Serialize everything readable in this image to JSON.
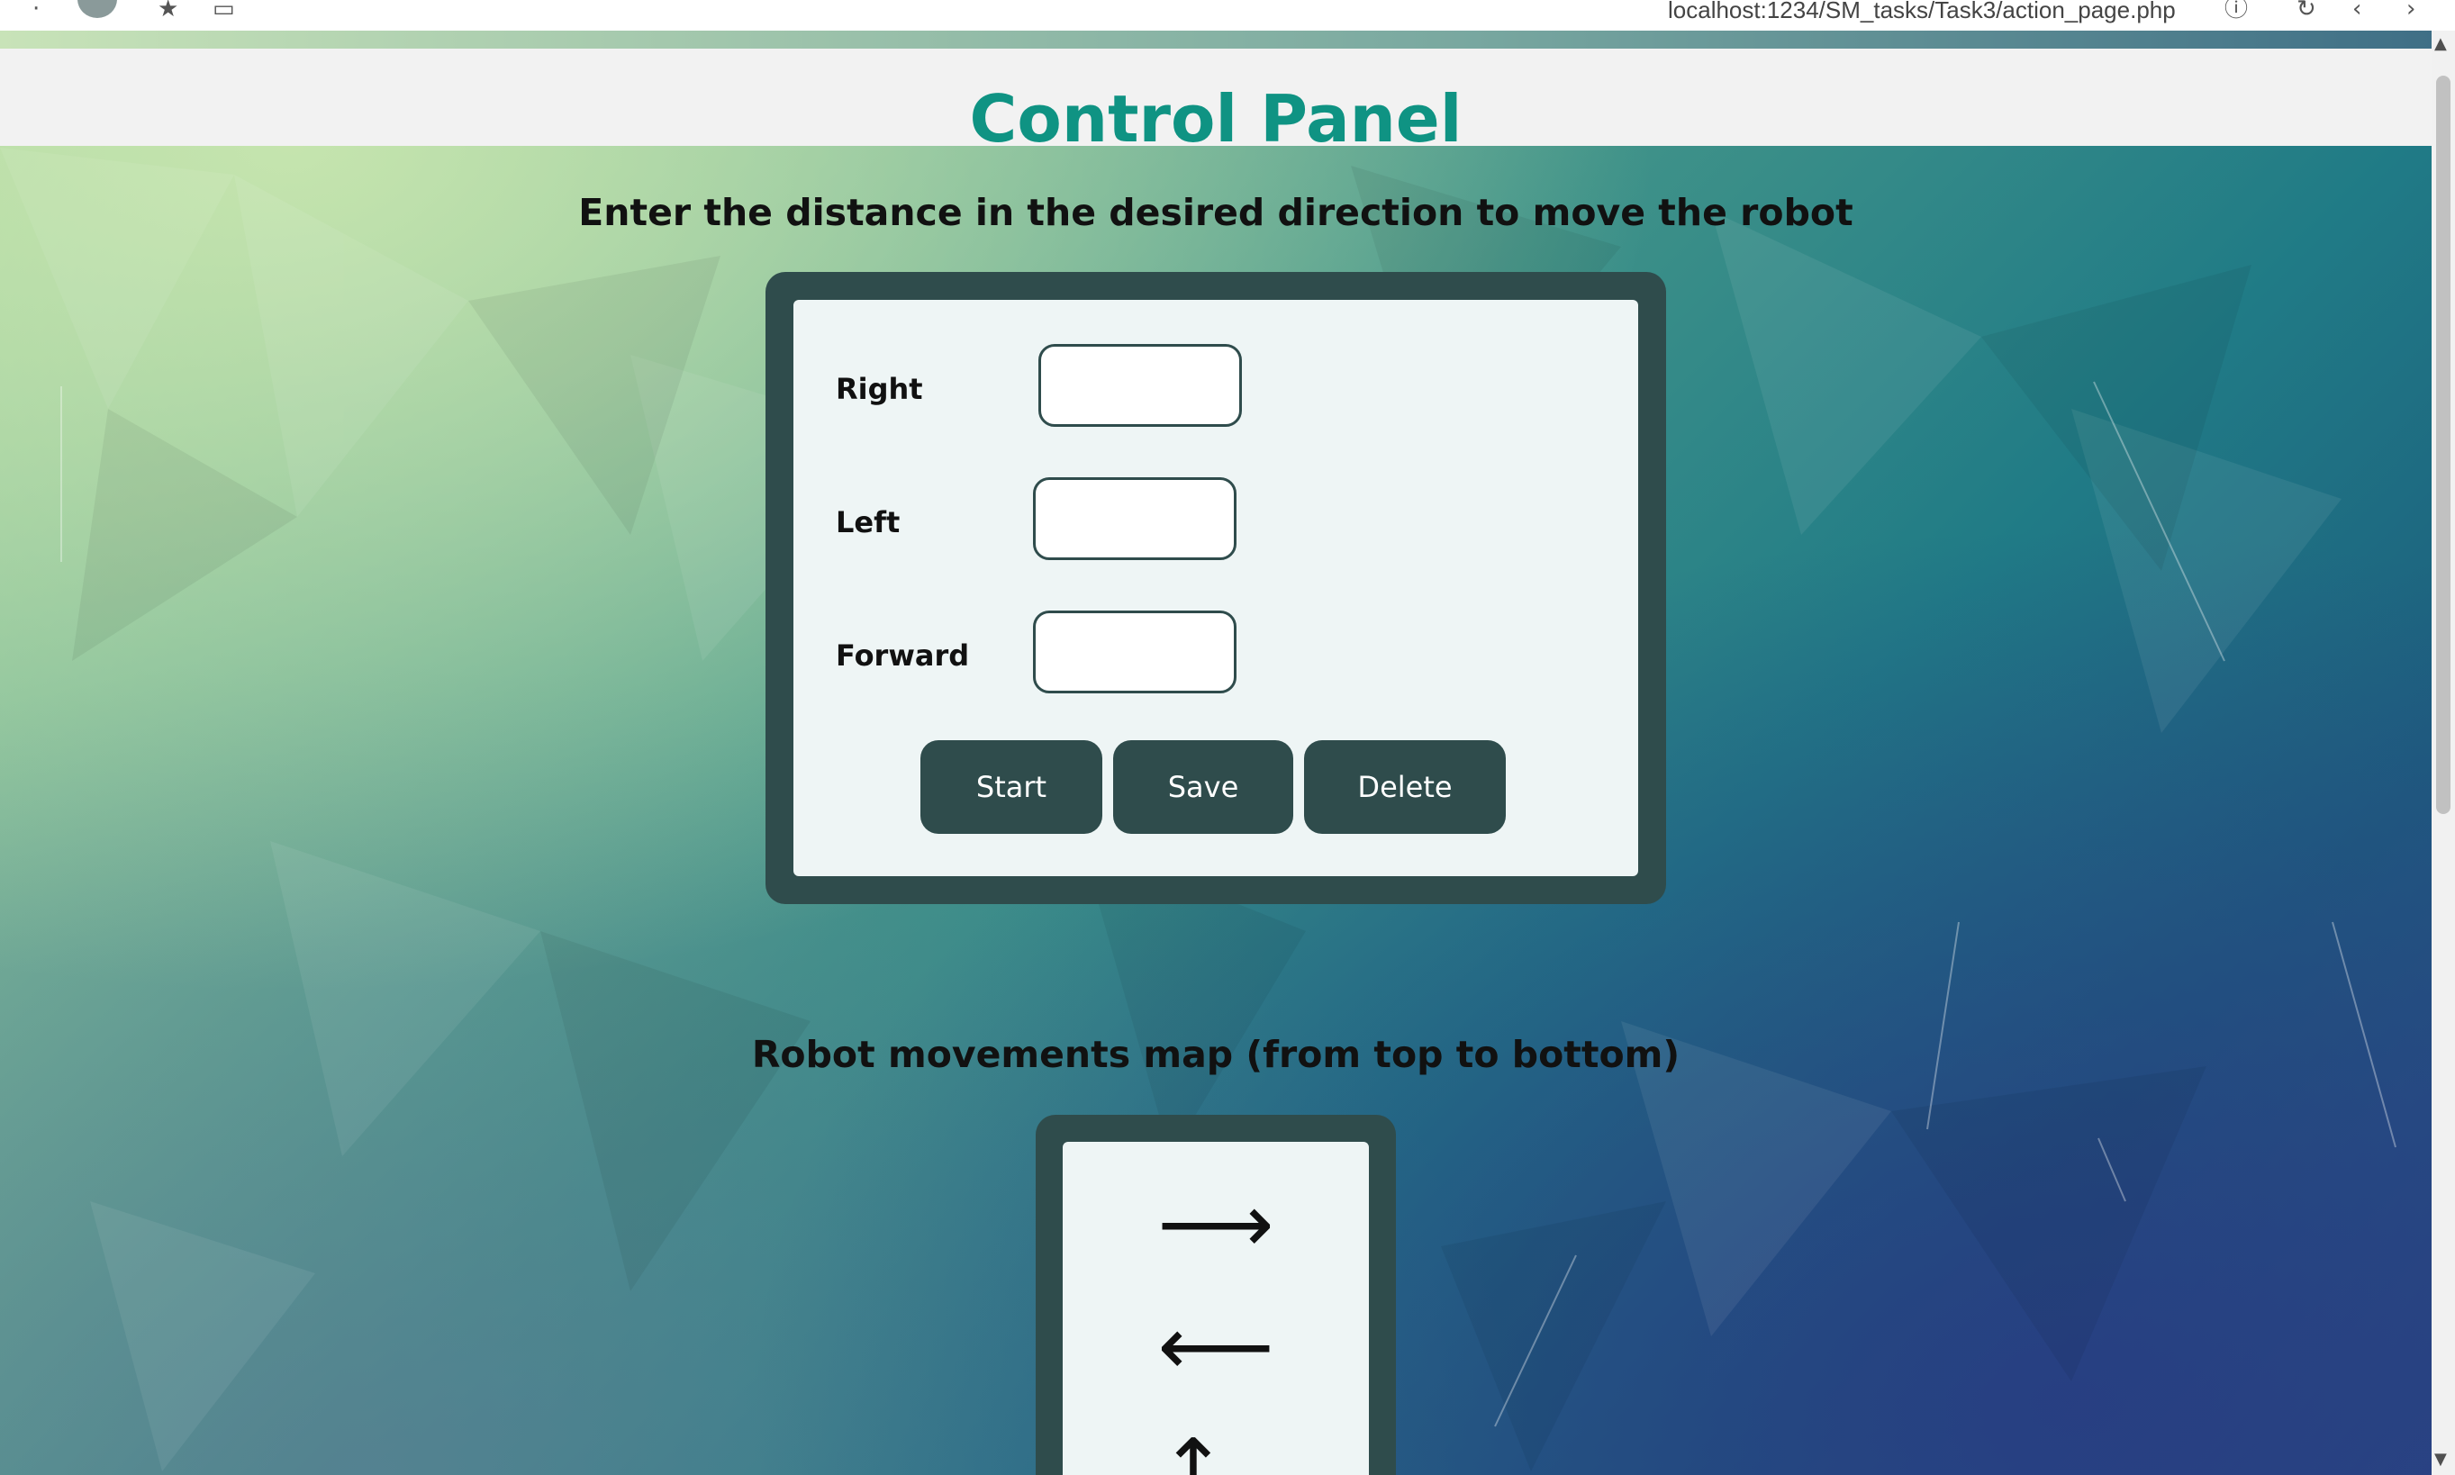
{
  "browser": {
    "url": "localhost:1234/SM_tasks/Task3/action_page.php"
  },
  "header": {
    "title": "Control Panel"
  },
  "instruction": "Enter the distance in the desired direction to move the robot",
  "form": {
    "fields": [
      {
        "label": "Right",
        "value": ""
      },
      {
        "label": "Left",
        "value": ""
      },
      {
        "label": "Forward",
        "value": ""
      }
    ],
    "buttons": {
      "start": "Start",
      "save": "Save",
      "delete": "Delete"
    }
  },
  "map": {
    "heading": "Robot movements map (from top to bottom)",
    "arrows": [
      "⟶",
      "⟵",
      "↑"
    ]
  },
  "colors": {
    "title": "#0f9383",
    "panel": "#2f4c4c",
    "panel_inner": "#eef5f5"
  },
  "icons": {
    "browser_menu": "dots-icon",
    "bookmark": "star-icon",
    "info": "info-icon",
    "reload": "reload-icon",
    "back": "back-icon"
  }
}
